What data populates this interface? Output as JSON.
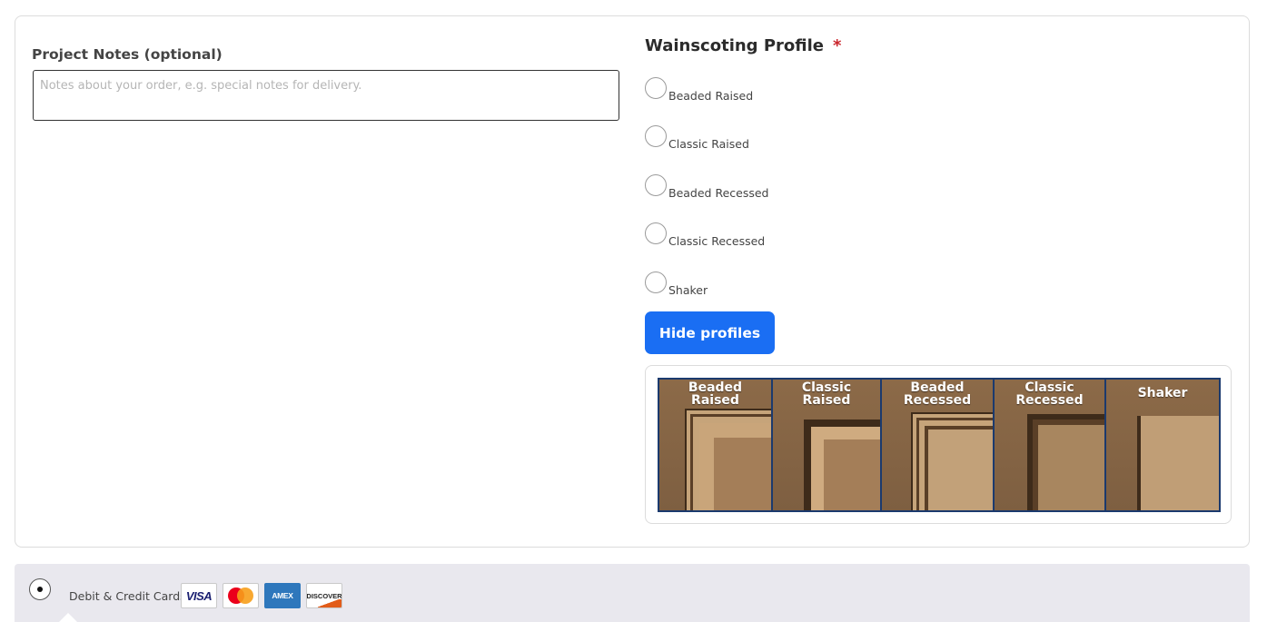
{
  "notes": {
    "label": "Project Notes (optional)",
    "placeholder": "Notes about your order, e.g. special notes for delivery.",
    "value": ""
  },
  "wainscoting": {
    "heading": "Wainscoting Profile",
    "required_marker": "*",
    "options": [
      {
        "label": "Beaded Raised",
        "selected": false
      },
      {
        "label": "Classic Raised",
        "selected": false
      },
      {
        "label": "Beaded Recessed",
        "selected": false
      },
      {
        "label": "Classic Recessed",
        "selected": false
      },
      {
        "label": "Shaker",
        "selected": false
      }
    ],
    "hide_button_label": "Hide profiles",
    "profile_image_titles": [
      "Beaded\nRaised",
      "Classic\nRaised",
      "Beaded\nRecessed",
      "Classic\nRecessed",
      "Shaker"
    ]
  },
  "payment": {
    "method_label": "Debit & Credit Cards",
    "selected": true,
    "card_logos": [
      "VISA",
      "mastercard",
      "AMEX",
      "DISCOVER"
    ]
  },
  "colors": {
    "button_blue": "#1a6ef3",
    "required_red": "#c9252c",
    "payment_bar_bg": "#e9e8ee",
    "profile_border": "#1b3a6e"
  }
}
